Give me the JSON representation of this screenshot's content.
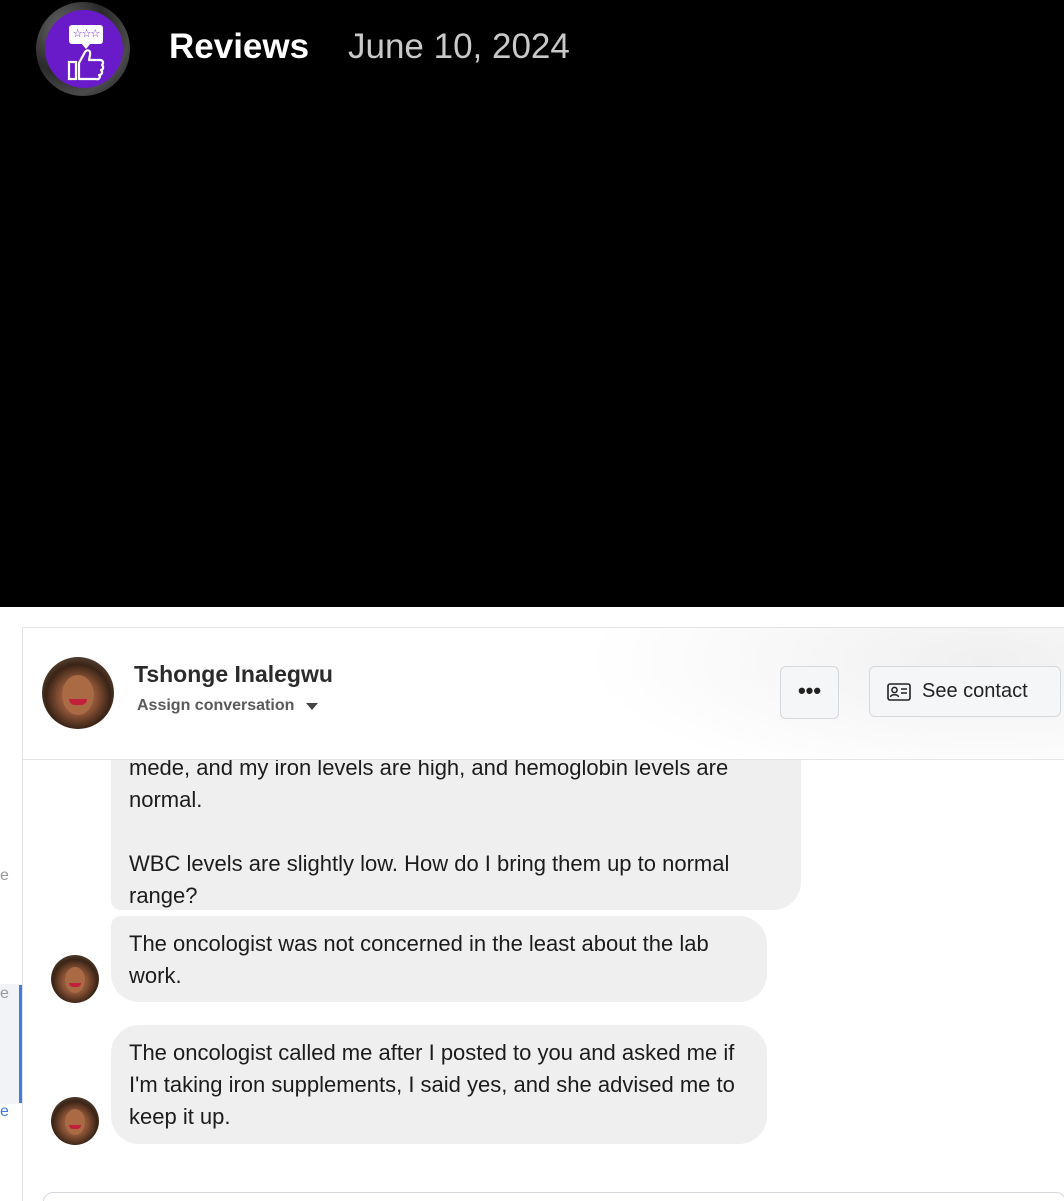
{
  "banner": {
    "title": "Reviews",
    "date": "June 10, 2024",
    "logo_icon": "thumbs-up-review-stars-icon",
    "logo_stars": "☆☆☆",
    "accent": "#6a1bc9"
  },
  "header": {
    "contact_name": "Tshonge Inalegwu",
    "assign_label": "Assign conversation",
    "more_label": "•••",
    "see_contact_label": "See contact"
  },
  "messages": [
    {
      "text": "mede, and my iron levels are high, and hemoglobin levels are normal.\n\nWBC levels are slightly low. How do I bring them up to normal range?"
    },
    {
      "text": "The oncologist was not concerned in the least about the lab work."
    },
    {
      "text": "The oncologist called me after I posted to you and asked me if I'm taking iron supplements, I said yes, and she advised me to keep it up."
    }
  ],
  "left_fragments": [
    "e",
    "e",
    "e"
  ],
  "colors": {
    "bubble": "#efefef",
    "selection_bar": "#3f7de0"
  }
}
